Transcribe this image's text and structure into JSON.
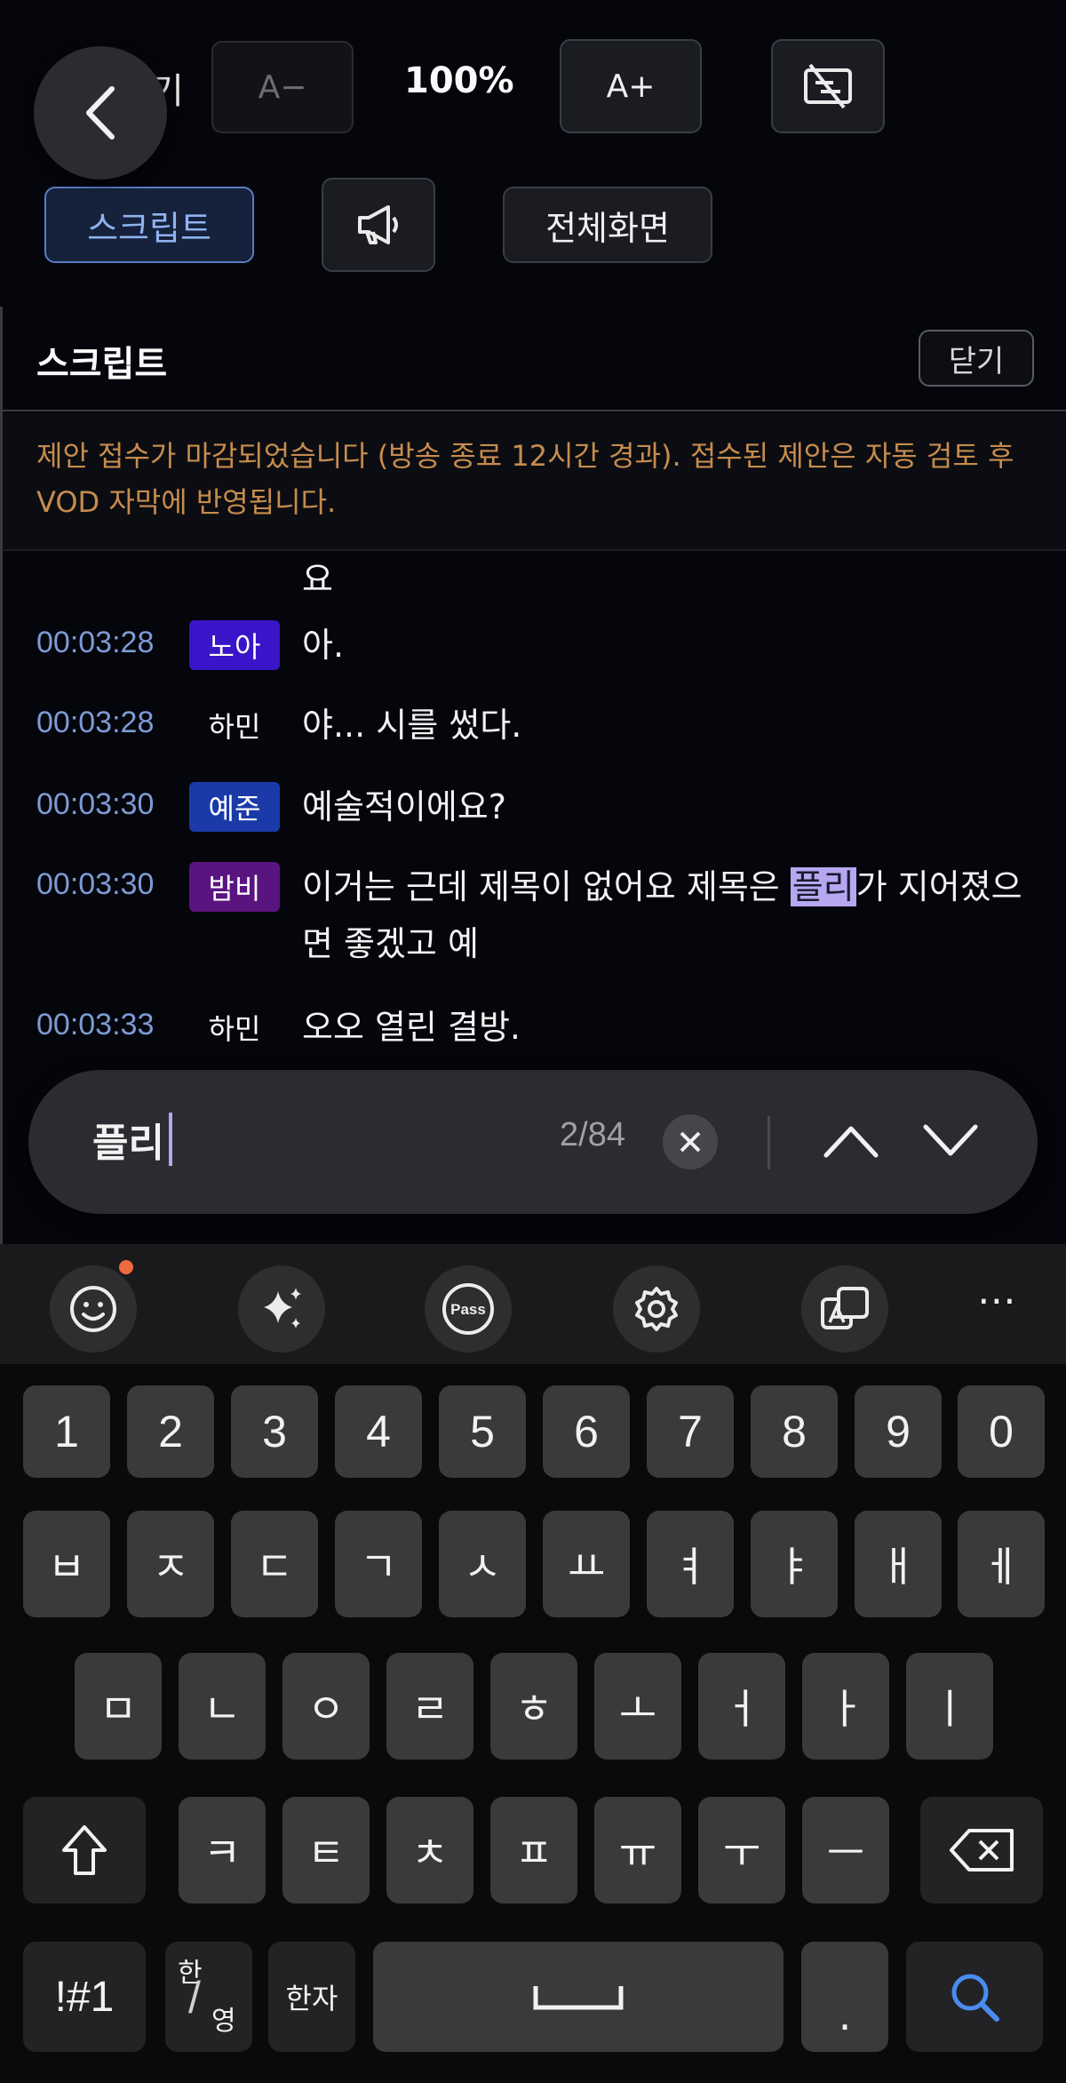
{
  "toolbar": {
    "partial_label": "기",
    "decrease_label": "A−",
    "zoom_value": "100%",
    "increase_label": "A+",
    "script_label": "스크립트",
    "fullscreen_label": "전체화면"
  },
  "panel": {
    "title": "스크립트",
    "close_label": "닫기",
    "notice": "제안 접수가 마감되었습니다 (방송 종료 12시간 경과). 접수된 제안은 자동 검토 후 VOD 자막에 반영됩니다."
  },
  "transcript": {
    "continuation": "요",
    "lines": [
      {
        "time": "00:03:28",
        "speaker": "노아",
        "text": "아."
      },
      {
        "time": "00:03:28",
        "speaker": "하민",
        "text": "야... 시를 썼다."
      },
      {
        "time": "00:03:30",
        "speaker": "예준",
        "text": "예술적이에요?"
      },
      {
        "time": "00:03:30",
        "speaker": "밤비",
        "text_before": "이거는 근데 제목이 없어요 제목은 ",
        "text_highlight": "플리",
        "text_after": "가 지어졌으면 좋겠고 예"
      },
      {
        "time": "00:03:33",
        "speaker": "하민",
        "text": "오오 열린 결방."
      }
    ]
  },
  "speaker_colors": {
    "노아": "#3a14c8",
    "하민": "#05060c",
    "예준": "#1a3aa8",
    "밤비": "#5a1480"
  },
  "search": {
    "query": "플리",
    "count": "2/84"
  },
  "keyboard": {
    "tools": [
      "emoji-icon",
      "sparkle-icon",
      "pass-icon",
      "gear-icon",
      "translate-icon"
    ],
    "more": "⋯",
    "pass_label": "Pass",
    "row_numbers": [
      "1",
      "2",
      "3",
      "4",
      "5",
      "6",
      "7",
      "8",
      "9",
      "0"
    ],
    "row1": [
      "ㅂ",
      "ㅈ",
      "ㄷ",
      "ㄱ",
      "ㅅ",
      "ㅛ",
      "ㅕ",
      "ㅑ",
      "ㅐ",
      "ㅔ"
    ],
    "row2": [
      "ㅁ",
      "ㄴ",
      "ㅇ",
      "ㄹ",
      "ㅎ",
      "ㅗ",
      "ㅓ",
      "ㅏ",
      "ㅣ"
    ],
    "row3": [
      "ㅋ",
      "ㅌ",
      "ㅊ",
      "ㅍ",
      "ㅠ",
      "ㅜ",
      "ㅡ"
    ],
    "symbols_label": "!#1",
    "lang_top": "한",
    "lang_bottom": "영",
    "hanja_label": "한자",
    "period_label": "."
  }
}
